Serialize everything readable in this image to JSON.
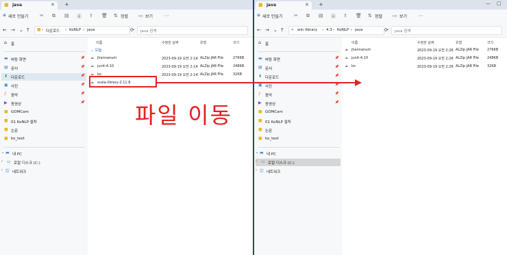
{
  "left": {
    "tab_title": "java",
    "toolbar": {
      "new": "새로 만들기",
      "sort": "정렬",
      "view": "보기"
    },
    "breadcrumb": [
      "다운로드",
      "KoNLP",
      "java"
    ],
    "search_placeholder": "java 검색",
    "sidebar": [
      {
        "icon": "home-icon",
        "label": "홈"
      },
      {
        "icon": "desktop-icon",
        "label": "바탕 화면",
        "pinned": true
      },
      {
        "icon": "document-icon",
        "label": "문서",
        "pinned": true
      },
      {
        "icon": "download-icon",
        "label": "다운로드",
        "pinned": true,
        "selected": true
      },
      {
        "icon": "picture-icon",
        "label": "사진",
        "pinned": true
      },
      {
        "icon": "music-icon",
        "label": "음악",
        "pinned": true
      },
      {
        "icon": "video-icon",
        "label": "동영상",
        "pinned": true
      },
      {
        "icon": "folder-icon",
        "label": "GOMCam"
      },
      {
        "icon": "folder-icon",
        "label": "01 KoNLP 설치"
      },
      {
        "icon": "folder-icon",
        "label": "논문"
      },
      {
        "icon": "folder-icon",
        "label": "ko_text"
      },
      {
        "icon": "pc-icon",
        "label": "내 PC"
      },
      {
        "icon": "drive-icon",
        "label": "로컬 디스크 (C:)"
      },
      {
        "icon": "network-icon",
        "label": "네트워크"
      }
    ],
    "columns": [
      "이름",
      "수정한 날짜",
      "유형",
      "크기"
    ],
    "group": "오늘",
    "files": [
      {
        "name": "jhannanum",
        "date": "2023-09-19 오전 2:14",
        "type": "ALZip JAR File",
        "size": "276KB"
      },
      {
        "name": "junit-4.10",
        "date": "2023-09-19 오전 2:14",
        "type": "ALZip JAR File",
        "size": "248KB"
      },
      {
        "name": "ko",
        "date": "2023-09-19 오전 2:14",
        "type": "ALZip JAR File",
        "size": "32KB"
      },
      {
        "name": "scala-library-2.11.8",
        "date": "",
        "type": "",
        "size": ""
      }
    ]
  },
  "right": {
    "tab_title": "java",
    "toolbar": {
      "new": "새로 만들기",
      "sort": "정렬",
      "view": "보기"
    },
    "breadcrumb": [
      "win-library",
      "4.3",
      "KoNLP",
      "java"
    ],
    "search_placeholder": "java 검색",
    "sidebar": [
      {
        "icon": "home-icon",
        "label": "홈"
      },
      {
        "icon": "desktop-icon",
        "label": "바탕 화면",
        "pinned": true
      },
      {
        "icon": "document-icon",
        "label": "문서",
        "pinned": true
      },
      {
        "icon": "download-icon",
        "label": "다운로드",
        "pinned": true
      },
      {
        "icon": "picture-icon",
        "label": "사진",
        "pinned": true
      },
      {
        "icon": "music-icon",
        "label": "음악",
        "pinned": true
      },
      {
        "icon": "video-icon",
        "label": "동영상",
        "pinned": true
      },
      {
        "icon": "folder-icon",
        "label": "GOMCam"
      },
      {
        "icon": "folder-icon",
        "label": "01 KoNLP 설치"
      },
      {
        "icon": "folder-icon",
        "label": "논문"
      },
      {
        "icon": "folder-icon",
        "label": "ko_text"
      },
      {
        "icon": "pc-icon",
        "label": "내 PC"
      },
      {
        "icon": "drive-icon",
        "label": "로컬 디스크 (C:)",
        "hovered": true
      },
      {
        "icon": "network-icon",
        "label": "네트워크"
      }
    ],
    "columns": [
      "이름",
      "수정한 날짜",
      "유형",
      "크기"
    ],
    "files": [
      {
        "name": "jhannanum",
        "date": "2023-09-19 오전 2:26",
        "type": "ALZip JAR File",
        "size": "276KB"
      },
      {
        "name": "junit-4.10",
        "date": "2023-09-19 오전 2:26",
        "type": "ALZip JAR File",
        "size": "248KB"
      },
      {
        "name": "ko",
        "date": "2023-09-19 오전 2:26",
        "type": "ALZip JAR File",
        "size": "32KB"
      }
    ]
  },
  "annotation": {
    "text": "파일 이동",
    "color": "#e52020"
  }
}
